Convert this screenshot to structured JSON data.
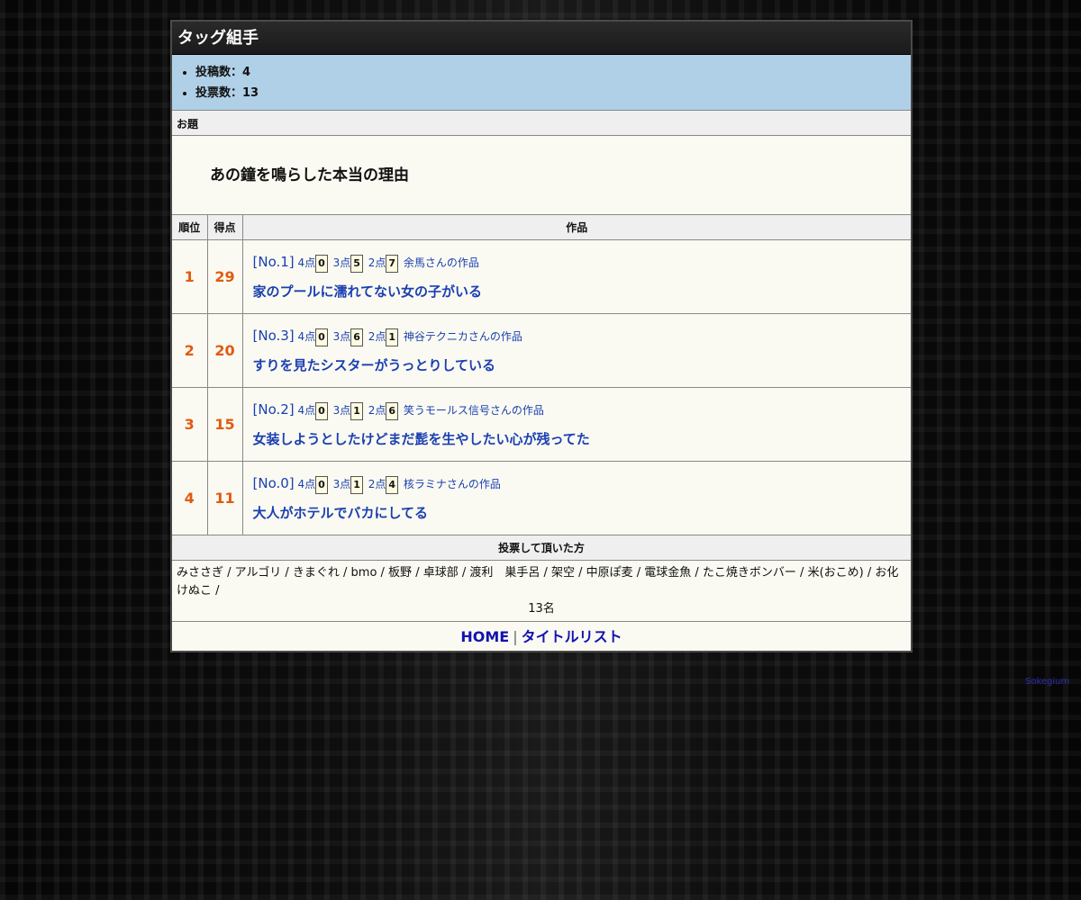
{
  "page": {
    "title": "タッグ組手",
    "stats": [
      {
        "label": "投稿数：4"
      },
      {
        "label": "投票数：13"
      }
    ],
    "odai_label": "お題",
    "odai": "あの鐘を鳴らした本当の理由"
  },
  "table": {
    "headers": {
      "rank": "順位",
      "score": "得点",
      "work": "作品"
    },
    "rows": [
      {
        "rank": "1",
        "score": "29",
        "no": "[No.1]",
        "p4_label": "4点",
        "p4": "0",
        "p3_label": "3点",
        "p3": "5",
        "p2_label": "2点",
        "p2": "7",
        "author": "余馬さんの作品",
        "title": "家のプールに濡れてない女の子がいる"
      },
      {
        "rank": "2",
        "score": "20",
        "no": "[No.3]",
        "p4_label": "4点",
        "p4": "0",
        "p3_label": "3点",
        "p3": "6",
        "p2_label": "2点",
        "p2": "1",
        "author": "神谷テクニカさんの作品",
        "title": "すりを見たシスターがうっとりしている"
      },
      {
        "rank": "3",
        "score": "15",
        "no": "[No.2]",
        "p4_label": "4点",
        "p4": "0",
        "p3_label": "3点",
        "p3": "1",
        "p2_label": "2点",
        "p2": "6",
        "author": "笑うモールス信号さんの作品",
        "title": "女装しようとしたけどまだ髭を生やしたい心が残ってた"
      },
      {
        "rank": "4",
        "score": "11",
        "no": "[No.0]",
        "p4_label": "4点",
        "p4": "0",
        "p3_label": "3点",
        "p3": "1",
        "p2_label": "2点",
        "p2": "4",
        "author": "核ラミナさんの作品",
        "title": "大人がホテルでバカにしてる"
      }
    ]
  },
  "voters": {
    "heading": "投票して頂いた方",
    "list": "みささぎ / アルゴリ / きまぐれ / bmo / 板野 / 卓球部 / 渡利　巣手呂 / 架空 / 中原ぽ麦 / 電球金魚 / たこ焼きボンバー / 米(おこめ) / お化けぬこ /",
    "count": "13名"
  },
  "nav": {
    "home": "HOME",
    "separator": "|",
    "titles": "タイトルリスト"
  },
  "credit": "Sokegium"
}
